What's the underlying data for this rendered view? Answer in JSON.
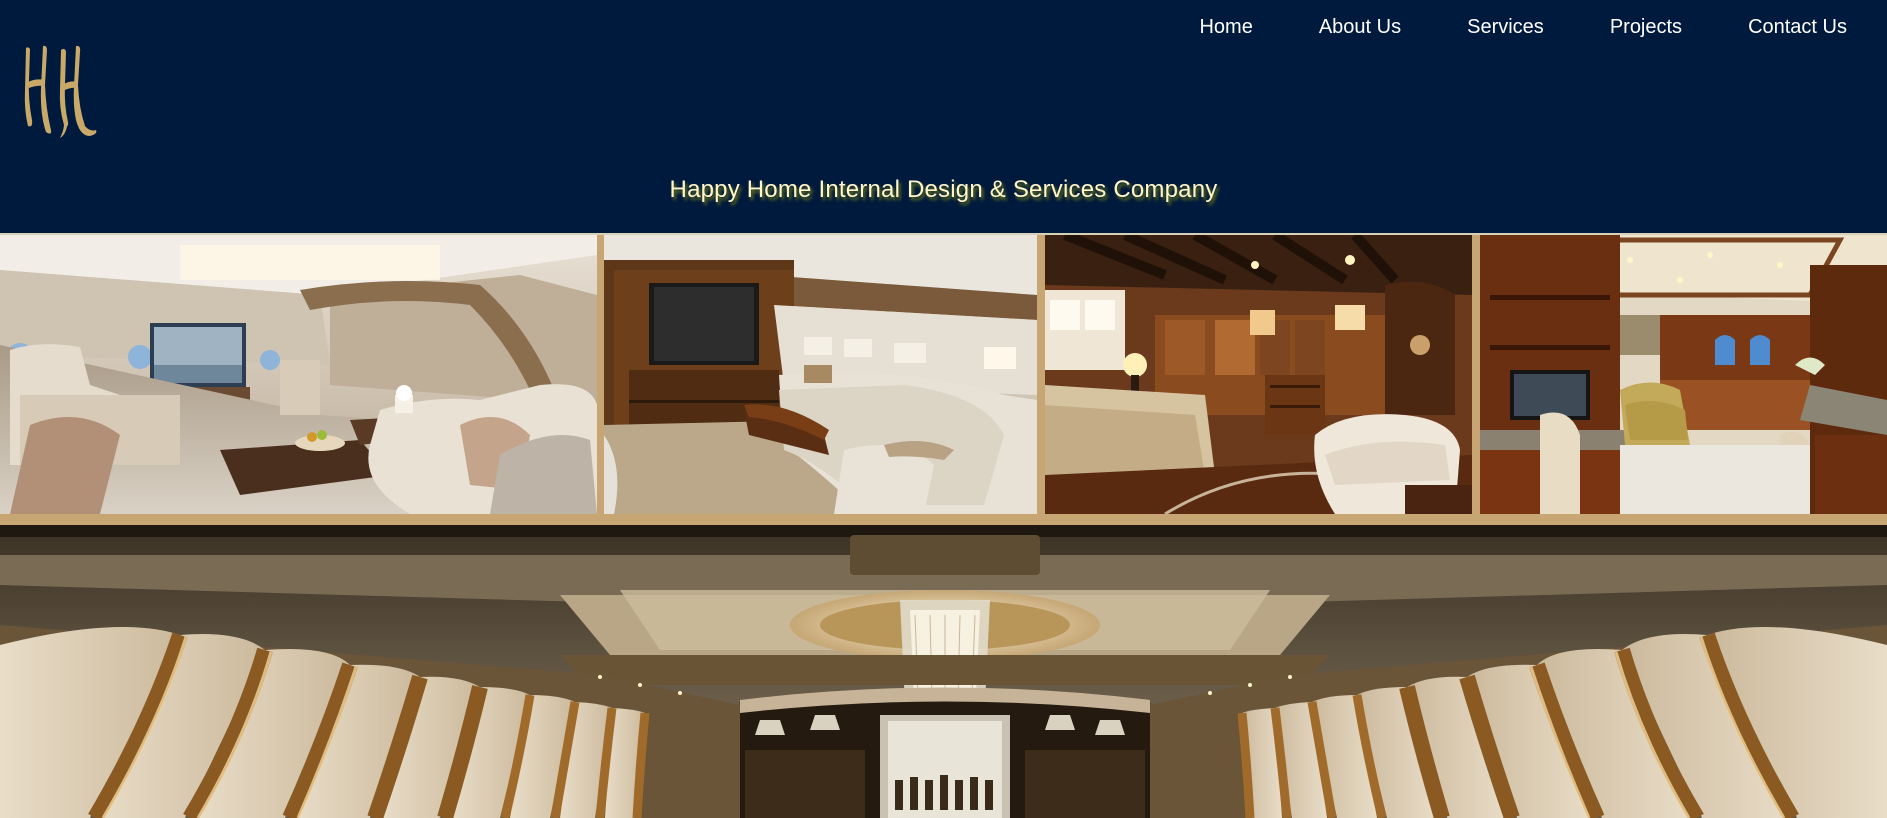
{
  "logo": {
    "text": "HH",
    "icon": "hh-logo"
  },
  "nav": {
    "items": [
      "Home",
      "About Us",
      "Services",
      "Projects",
      "Contact Us"
    ]
  },
  "tagline": "Happy Home Internal Design & Services Company",
  "gallery": {
    "images": [
      "jet-lounge-image",
      "jet-living-room-image",
      "yacht-bedroom-image",
      "yacht-office-image"
    ]
  },
  "hero": {
    "image": "jet-cabin-bar-image"
  },
  "colors": {
    "header_bg": "#001a3d",
    "gold": "#c8a673",
    "tagline": "#fff6cc",
    "nav_text": "#ffffff"
  }
}
